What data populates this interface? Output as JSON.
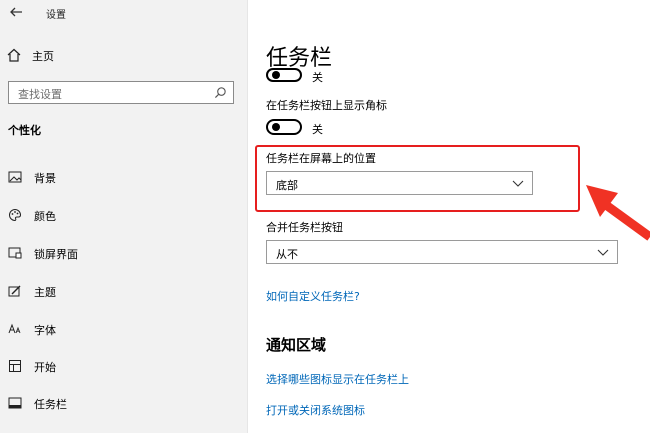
{
  "window": {
    "title": "设置"
  },
  "sidebar": {
    "home_label": "主页",
    "search_placeholder": "查找设置",
    "section": "个性化",
    "items": [
      {
        "label": "背景",
        "icon": "picture-icon"
      },
      {
        "label": "颜色",
        "icon": "palette-icon"
      },
      {
        "label": "锁屏界面",
        "icon": "lock-screen-icon"
      },
      {
        "label": "主题",
        "icon": "theme-brush-icon"
      },
      {
        "label": "字体",
        "icon": "font-icon"
      },
      {
        "label": "开始",
        "icon": "start-icon"
      },
      {
        "label": "任务栏",
        "icon": "taskbar-icon"
      }
    ]
  },
  "main": {
    "title": "任务栏",
    "partial_toggle_state": "关",
    "badges_label": "在任务栏按钮上显示角标",
    "badges_state": "关",
    "position_label": "任务栏在屏幕上的位置",
    "position_value": "底部",
    "combine_label": "合并任务栏按钮",
    "combine_value": "从不",
    "customize_link": "如何自定义任务栏?",
    "notification_title": "通知区域",
    "select_icons_link": "选择哪些图标显示在任务栏上",
    "system_icons_link": "打开或关闭系统图标"
  },
  "colors": {
    "accent_link": "#0067b8",
    "highlight": "#e61e1e"
  }
}
